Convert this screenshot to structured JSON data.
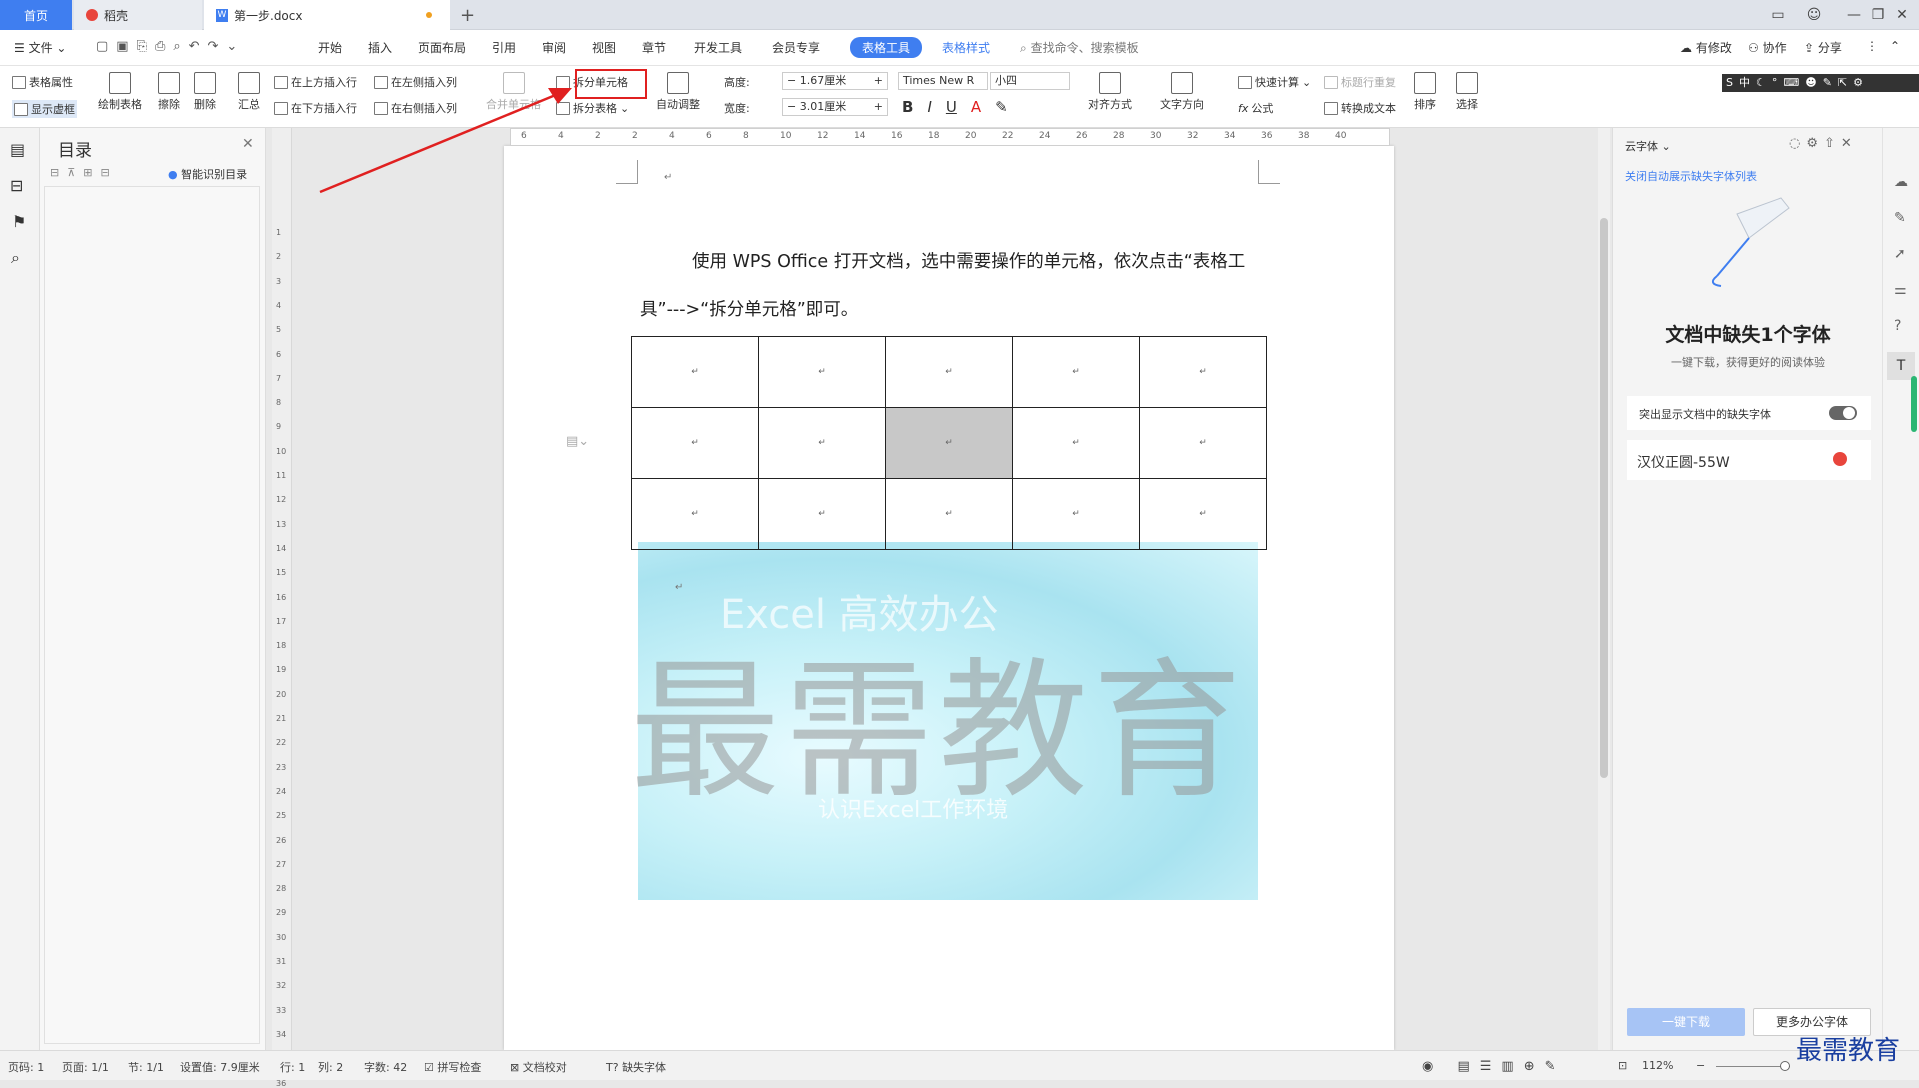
{
  "tabs": {
    "home": "首页",
    "daoke": "稻壳",
    "doc": "第一步.docx",
    "add": "+"
  },
  "menu": {
    "file": "文件",
    "items": [
      "开始",
      "插入",
      "页面布局",
      "引用",
      "审阅",
      "视图",
      "章节",
      "开发工具",
      "会员专享"
    ],
    "active": "表格工具",
    "style": "表格样式",
    "search": "查找命令、搜索模板",
    "modified": "有修改",
    "collab": "协作",
    "share": "分享"
  },
  "ribbon": {
    "table_props": "表格属性",
    "show_grid": "显示虚框",
    "draw": "绘制表格",
    "erase": "擦除",
    "delete": "删除",
    "sum": "汇总",
    "ins_above": "在上方插入行",
    "ins_below": "在下方插入行",
    "ins_left": "在左侧插入列",
    "ins_right": "在右侧插入列",
    "merge": "合并单元格",
    "split_cell": "拆分单元格",
    "split_table": "拆分表格",
    "auto_adjust": "自动调整",
    "height_label": "高度:",
    "height_value": "1.67厘米",
    "width_label": "宽度:",
    "width_value": "3.01厘米",
    "font_name": "Times New R",
    "font_size": "小四",
    "align": "对齐方式",
    "text_dir": "文字方向",
    "quick_calc": "快速计算",
    "formula": "公式",
    "title_repeat": "标题行重复",
    "to_text": "转换成文本",
    "sort": "排序",
    "select": "选择"
  },
  "toc": {
    "title": "目录",
    "smart": "智能识别目录"
  },
  "document": {
    "paragraph": "使用 WPS Office 打开文档，选中需要操作的单元格，依次点击“表格工具”--->“拆分单元格”即可。",
    "watermark": "最需教育",
    "banner_text1": "Excel 高效办公",
    "banner_text2": "认识Excel工作环境"
  },
  "ruler_marks": [
    "6",
    "4",
    "2",
    "2",
    "4",
    "6",
    "8",
    "10",
    "12",
    "14",
    "16",
    "18",
    "20",
    "22",
    "24",
    "26",
    "28",
    "30",
    "32",
    "34",
    "36",
    "38",
    "40"
  ],
  "vruler_marks": [
    "1",
    "2",
    "3",
    "4",
    "5",
    "6",
    "7",
    "8",
    "9",
    "10",
    "11",
    "12",
    "13",
    "14",
    "15",
    "16",
    "17",
    "18",
    "19",
    "20",
    "21",
    "22",
    "23",
    "24",
    "25",
    "26",
    "27",
    "28",
    "29",
    "30",
    "31",
    "32",
    "33",
    "34",
    "35",
    "36"
  ],
  "rpanel": {
    "title": "云字体",
    "close_auto": "关闭自动展示缺失字体列表",
    "missing": "文档中缺失1个字体",
    "subtitle": "一键下载，获得更好的阅读体验",
    "highlight": "突出显示文档中的缺失字体",
    "font": "汉仪正圆-55W",
    "download": "一键下载",
    "more": "更多办公字体"
  },
  "status": {
    "page": "页码: 1",
    "pages": "页面: 1/1",
    "section": "节: 1/1",
    "setting": "设置值: 7.9厘米",
    "row": "行: 1",
    "col": "列: 2",
    "words": "字数: 42",
    "spell": "拼写检查",
    "proof": "文档校对",
    "missing_font": "缺失字体",
    "zoom": "112%"
  },
  "brand": "最需教育",
  "colors": {
    "accent": "#3f7ef0",
    "highlight_box": "#e02020"
  }
}
